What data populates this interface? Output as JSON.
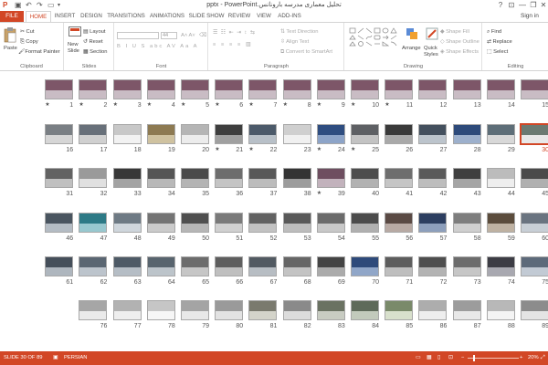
{
  "titlebar": {
    "title": "تحلیل معماری مدرسه بارونانس.pptx - PowerPoint",
    "question": "?",
    "minimize": "—",
    "restore": "❐",
    "close": "✕"
  },
  "tabs": [
    "FILE",
    "HOME",
    "INSERT",
    "DESIGN",
    "TRANSITIONS",
    "ANIMATIONS",
    "SLIDE SHOW",
    "REVIEW",
    "VIEW",
    "ADD-INS"
  ],
  "sign_in": "Sign in",
  "ribbon": {
    "clipboard": {
      "label": "Clipboard",
      "paste": "Paste",
      "cut": "Cut",
      "copy": "Copy",
      "format_painter": "Format Painter"
    },
    "slides": {
      "label": "Slides",
      "new_slide": "New",
      "new_slide2": "Slide",
      "layout": "Layout",
      "reset": "Reset",
      "section": "Section"
    },
    "font": {
      "label": "Font",
      "size": "44"
    },
    "paragraph": {
      "label": "Paragraph",
      "text_direction": "Text Direction",
      "align_text": "Align Text",
      "convert": "Convert to SmartArt"
    },
    "drawing": {
      "label": "Drawing",
      "arrange": "Arrange",
      "quick_styles": "Quick",
      "quick_styles2": "Styles",
      "shape_fill": "Shape Fill",
      "shape_outline": "Shape Outline",
      "shape_effects": "Shape Effects"
    },
    "editing": {
      "label": "Editing",
      "find": "Find",
      "replace": "Replace",
      "select": "Select"
    }
  },
  "slides": [
    {
      "n": "15",
      "s": false,
      "c": "#7d5668",
      "c2": "#c9bcc4"
    },
    {
      "n": "14",
      "s": false,
      "c": "#7d5668",
      "c2": "#c9bcc4"
    },
    {
      "n": "13",
      "s": false,
      "c": "#7d5668",
      "c2": "#c9bcc4"
    },
    {
      "n": "12",
      "s": false,
      "c": "#7d5668",
      "c2": "#c9bcc4"
    },
    {
      "n": "11",
      "s": true,
      "c": "#7d5668",
      "c2": "#c9bcc4"
    },
    {
      "n": "10",
      "s": true,
      "c": "#7d5668",
      "c2": "#c9bcc4"
    },
    {
      "n": "9",
      "s": true,
      "c": "#7d5668",
      "c2": "#c9bcc4"
    },
    {
      "n": "8",
      "s": true,
      "c": "#7d5668",
      "c2": "#c9bcc4"
    },
    {
      "n": "7",
      "s": true,
      "c": "#7d5668",
      "c2": "#c9bcc4"
    },
    {
      "n": "6",
      "s": true,
      "c": "#7d5668",
      "c2": "#c9bcc4"
    },
    {
      "n": "5",
      "s": true,
      "c": "#7d5668",
      "c2": "#c9bcc4"
    },
    {
      "n": "4",
      "s": true,
      "c": "#7d5668",
      "c2": "#c9bcc4"
    },
    {
      "n": "3",
      "s": true,
      "c": "#7d5668",
      "c2": "#c9bcc4"
    },
    {
      "n": "2",
      "s": true,
      "c": "#7d5668",
      "c2": "#c9bcc4"
    },
    {
      "n": "1",
      "s": true,
      "c": "#7d5668",
      "c2": "#c9bcc4"
    },
    {
      "n": "30",
      "s": false,
      "c": "#6b7a72",
      "c2": "#e8e8e8"
    },
    {
      "n": "29",
      "s": false,
      "c": "#5e6e78",
      "c2": "#d8d8d8"
    },
    {
      "n": "28",
      "s": false,
      "c": "#2d4a7a",
      "c2": "#9db0cc"
    },
    {
      "n": "27",
      "s": false,
      "c": "#44505e",
      "c2": "#bcc4cc"
    },
    {
      "n": "26",
      "s": false,
      "c": "#3a3a3a",
      "c2": "#a9a9a9"
    },
    {
      "n": "25",
      "s": true,
      "c": "#5e6064",
      "c2": "#c3c3c3"
    },
    {
      "n": "24",
      "s": true,
      "c": "#2e4d80",
      "c2": "#8da4c8"
    },
    {
      "n": "23",
      "s": false,
      "c": "#cfcfcf",
      "c2": "#f0f0f0"
    },
    {
      "n": "22",
      "s": true,
      "c": "#4c5a6a",
      "c2": "#b8c0c8"
    },
    {
      "n": "21",
      "s": true,
      "c": "#3e3e3e",
      "c2": "#a0a0a0"
    },
    {
      "n": "20",
      "s": false,
      "c": "#b5b5b5",
      "c2": "#ececec"
    },
    {
      "n": "19",
      "s": false,
      "c": "#8d7a52",
      "c2": "#cfc2a0"
    },
    {
      "n": "18",
      "s": false,
      "c": "#c8c8c8",
      "c2": "#f2f2f2"
    },
    {
      "n": "17",
      "s": false,
      "c": "#68707a",
      "c2": "#d0d0d0"
    },
    {
      "n": "16",
      "s": false,
      "c": "#7a7f84",
      "c2": "#d6d6d6"
    },
    {
      "n": "45",
      "s": false,
      "c": "#4a4a4a",
      "c2": "#b0b0b0"
    },
    {
      "n": "44",
      "s": false,
      "c": "#bcbcbc",
      "c2": "#eeeeee"
    },
    {
      "n": "43",
      "s": false,
      "c": "#3f3f3f",
      "c2": "#a5a5a5"
    },
    {
      "n": "42",
      "s": false,
      "c": "#5a5a5a",
      "c2": "#bdbdbd"
    },
    {
      "n": "41",
      "s": false,
      "c": "#6e6e6e",
      "c2": "#c5c5c5"
    },
    {
      "n": "40",
      "s": false,
      "c": "#4d4d4d",
      "c2": "#b2b2b2"
    },
    {
      "n": "39",
      "s": true,
      "c": "#6e4e60",
      "c2": "#c2b2bc"
    },
    {
      "n": "38",
      "s": false,
      "c": "#343434",
      "c2": "#9c9c9c"
    },
    {
      "n": "37",
      "s": false,
      "c": "#585858",
      "c2": "#bcbcbc"
    },
    {
      "n": "36",
      "s": false,
      "c": "#6d6d6d",
      "c2": "#c4c4c4"
    },
    {
      "n": "35",
      "s": false,
      "c": "#4b4b4b",
      "c2": "#b4b4b4"
    },
    {
      "n": "34",
      "s": false,
      "c": "#555555",
      "c2": "#b8b8b8"
    },
    {
      "n": "33",
      "s": false,
      "c": "#383838",
      "c2": "#a3a3a3"
    },
    {
      "n": "32",
      "s": false,
      "c": "#9a9a9a",
      "c2": "#e0e0e0"
    },
    {
      "n": "31",
      "s": false,
      "c": "#626262",
      "c2": "#c0c0c0"
    },
    {
      "n": "60",
      "s": false,
      "c": "#6a7480",
      "c2": "#c8cfd6"
    },
    {
      "n": "59",
      "s": false,
      "c": "#5b4c3c",
      "c2": "#bfb2a2"
    },
    {
      "n": "58",
      "s": false,
      "c": "#7e7e7e",
      "c2": "#cfcfcf"
    },
    {
      "n": "57",
      "s": false,
      "c": "#2c3e60",
      "c2": "#8d9fbc"
    },
    {
      "n": "56",
      "s": false,
      "c": "#5a4a44",
      "c2": "#b8aaa4"
    },
    {
      "n": "55",
      "s": false,
      "c": "#4c4c4c",
      "c2": "#b0b0b0"
    },
    {
      "n": "54",
      "s": false,
      "c": "#6b6b6b",
      "c2": "#c8c8c8"
    },
    {
      "n": "53",
      "s": false,
      "c": "#595959",
      "c2": "#bdbdbd"
    },
    {
      "n": "52",
      "s": false,
      "c": "#626262",
      "c2": "#c2c2c2"
    },
    {
      "n": "51",
      "s": false,
      "c": "#7a7a7a",
      "c2": "#d0d0d0"
    },
    {
      "n": "50",
      "s": false,
      "c": "#4f4f4f",
      "c2": "#b6b6b6"
    },
    {
      "n": "49",
      "s": false,
      "c": "#747474",
      "c2": "#cbcbcb"
    },
    {
      "n": "48",
      "s": false,
      "c": "#6e7a84",
      "c2": "#cfd6dc"
    },
    {
      "n": "47",
      "s": false,
      "c": "#2d7a86",
      "c2": "#98c8cf"
    },
    {
      "n": "46",
      "s": false,
      "c": "#4a5560",
      "c2": "#b4bcc4"
    },
    {
      "n": "75",
      "s": false,
      "c": "#5d6a7a",
      "c2": "#c2cad4"
    },
    {
      "n": "74",
      "s": false,
      "c": "#3c3c44",
      "c2": "#a8a8b0"
    },
    {
      "n": "73",
      "s": false,
      "c": "#6c6c6c",
      "c2": "#c6c6c6"
    },
    {
      "n": "72",
      "s": false,
      "c": "#4e4e4e",
      "c2": "#b3b3b3"
    },
    {
      "n": "71",
      "s": false,
      "c": "#5d5d5d",
      "c2": "#bebebe"
    },
    {
      "n": "70",
      "s": false,
      "c": "#2e4a7a",
      "c2": "#90a6c8"
    },
    {
      "n": "69",
      "s": false,
      "c": "#444444",
      "c2": "#ababab"
    },
    {
      "n": "68",
      "s": false,
      "c": "#666666",
      "c2": "#c3c3c3"
    },
    {
      "n": "67",
      "s": false,
      "c": "#525a62",
      "c2": "#b7bdc3"
    },
    {
      "n": "66",
      "s": false,
      "c": "#5e5e5e",
      "c2": "#bfbfbf"
    },
    {
      "n": "65",
      "s": false,
      "c": "#6c6c6c",
      "c2": "#c6c6c6"
    },
    {
      "n": "64",
      "s": false,
      "c": "#58646e",
      "c2": "#bcc4ca"
    },
    {
      "n": "63",
      "s": false,
      "c": "#4e5a66",
      "c2": "#b5bdc5"
    },
    {
      "n": "62",
      "s": false,
      "c": "#5a6672",
      "c2": "#bcc4cc"
    },
    {
      "n": "61",
      "s": false,
      "c": "#454f5a",
      "c2": "#aeb6be"
    },
    {
      "n": "89",
      "s": false,
      "c": "#8c8c8c",
      "c2": "#e4e4e4"
    },
    {
      "n": "88",
      "s": false,
      "c": "#b8b8b8",
      "c2": "#f4f4f4"
    },
    {
      "n": "87",
      "s": false,
      "c": "#9c9c9c",
      "c2": "#e8e8e8"
    },
    {
      "n": "86",
      "s": false,
      "c": "#adadad",
      "c2": "#eeeeee"
    },
    {
      "n": "85",
      "s": false,
      "c": "#7a8a6a",
      "c2": "#d8e0cc"
    },
    {
      "n": "84",
      "s": false,
      "c": "#5e6a5a",
      "c2": "#c2cabc"
    },
    {
      "n": "83",
      "s": false,
      "c": "#6a7262",
      "c2": "#c8ccc2"
    },
    {
      "n": "82",
      "s": false,
      "c": "#8a8a8a",
      "c2": "#dcdcdc"
    },
    {
      "n": "81",
      "s": false,
      "c": "#7a7a6e",
      "c2": "#d4d4ca"
    },
    {
      "n": "80",
      "s": false,
      "c": "#9a9a9a",
      "c2": "#e2e2e2"
    },
    {
      "n": "79",
      "s": false,
      "c": "#a4a4a4",
      "c2": "#e8e8e8"
    },
    {
      "n": "78",
      "s": false,
      "c": "#c6c6c6",
      "c2": "#f6f6f6"
    },
    {
      "n": "77",
      "s": false,
      "c": "#b2b2b2",
      "c2": "#eeeeee"
    },
    {
      "n": "76",
      "s": false,
      "c": "#a6a6a6",
      "c2": "#eaeaea"
    }
  ],
  "status": {
    "slide": "SLIDE 30 OF 89",
    "language": "PERSIAN",
    "zoom": "20%"
  },
  "colors": {
    "accent": "#d24726"
  }
}
